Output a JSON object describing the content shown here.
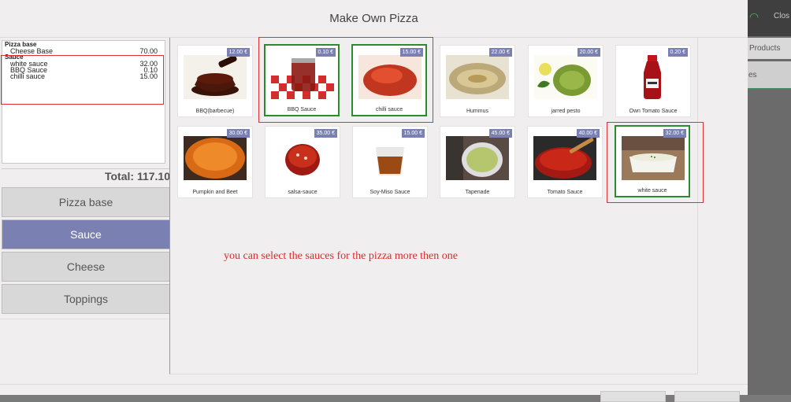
{
  "background": {
    "close_label": "Clos",
    "tab_products": "Products",
    "tab_other": "es"
  },
  "modal": {
    "title": "Make Own Pizza"
  },
  "receipt": {
    "pizza_base_heading": "Pizza base",
    "pizza_base_lines": [
      {
        "name": "Cheese Base",
        "price": "70.00"
      }
    ],
    "sauce_heading": "Sauce",
    "sauce_lines": [
      {
        "name": "white sauce",
        "price": "32.00"
      },
      {
        "name": "BBQ Sauce",
        "price": "0.10"
      },
      {
        "name": "chilli sauce",
        "price": "15.00"
      }
    ]
  },
  "total": "Total: 117.10",
  "categories": [
    "Pizza base",
    "Sauce",
    "Cheese",
    "Toppings"
  ],
  "products": [
    {
      "name": "BBQ(barbecue)",
      "price": "12.00 €",
      "selected": false,
      "icon": "bbq-sauce-image"
    },
    {
      "name": "BBQ Sauce",
      "price": "0.10 €",
      "selected": true,
      "icon": "bbq-sauce-jar-image"
    },
    {
      "name": "chilli sauce",
      "price": "15.00 €",
      "selected": true,
      "icon": "chilli-sauce-image"
    },
    {
      "name": "Hummus",
      "price": "22.00 €",
      "selected": false,
      "icon": "hummus-image"
    },
    {
      "name": "jarred pesto",
      "price": "20.00 €",
      "selected": false,
      "icon": "pesto-image"
    },
    {
      "name": "Own Tomato Sauce",
      "price": "0.20 €",
      "selected": false,
      "icon": "ketchup-bottle-image"
    },
    {
      "name": "Pumpkin and Beet",
      "price": "30.00 €",
      "selected": false,
      "icon": "pumpkin-sauce-image"
    },
    {
      "name": "salsa-sauce",
      "price": "35.00 €",
      "selected": false,
      "icon": "salsa-image"
    },
    {
      "name": "Soy-Miso Sauce",
      "price": "15.00 €",
      "selected": false,
      "icon": "soy-miso-image"
    },
    {
      "name": "Tapenade",
      "price": "45.00 €",
      "selected": false,
      "icon": "tapenade-image"
    },
    {
      "name": "Tomato Sauce",
      "price": "40.00 €",
      "selected": false,
      "icon": "tomato-sauce-image"
    },
    {
      "name": "white sauce",
      "price": "32.00 €",
      "selected": true,
      "icon": "white-sauce-image"
    }
  ],
  "annotation": "you can select the sauces for the pizza more then one",
  "colors": {
    "accent": "#7b80b2",
    "selected_border": "#2a8c2f",
    "annotation_red": "#d42c2c"
  }
}
